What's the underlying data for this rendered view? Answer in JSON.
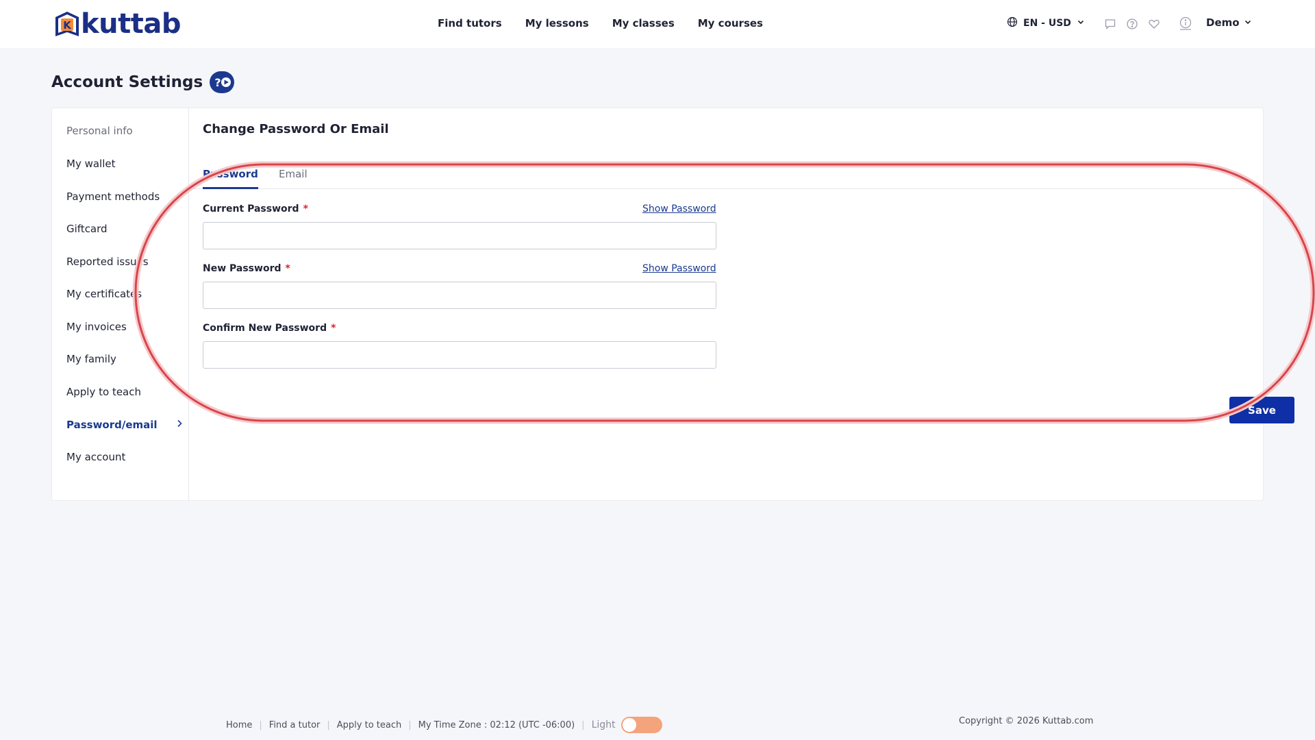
{
  "brand": {
    "name": "kuttab",
    "logo_letter": "K",
    "color": "#1b2f86",
    "accent": "#f28b3b"
  },
  "nav": {
    "items": [
      "Find tutors",
      "My lessons",
      "My classes",
      "My courses"
    ]
  },
  "header": {
    "language": "EN - USD",
    "icons": [
      "globe-icon",
      "chat-icon",
      "help-circle-icon",
      "heart-icon",
      "info-icon"
    ],
    "user_name": "Demo"
  },
  "page": {
    "title": "Account Settings"
  },
  "sidebar": {
    "items": [
      {
        "label": "Personal info",
        "state": "muted"
      },
      {
        "label": "My wallet"
      },
      {
        "label": "Payment methods"
      },
      {
        "label": "Giftcard"
      },
      {
        "label": "Reported issues"
      },
      {
        "label": "My certificates"
      },
      {
        "label": "My invoices"
      },
      {
        "label": "My family"
      },
      {
        "label": "Apply to teach"
      },
      {
        "label": "Password/email",
        "state": "active"
      },
      {
        "label": "My account"
      }
    ]
  },
  "content": {
    "title": "Change Password Or Email",
    "tabs": [
      {
        "label": "Password",
        "active": true
      },
      {
        "label": "Email"
      }
    ],
    "fields": {
      "current": {
        "label": "Current Password",
        "required": "*",
        "show": "Show Password",
        "value": ""
      },
      "new": {
        "label": "New Password",
        "required": "*",
        "show": "Show Password",
        "value": ""
      },
      "confirm": {
        "label": "Confirm New Password",
        "required": "*",
        "value": ""
      }
    },
    "save_label": "Save"
  },
  "footer": {
    "links": [
      "Home",
      "Find a tutor",
      "Apply to teach"
    ],
    "timezone": "My Time Zone : 02:12 (UTC -06:00)",
    "theme_label": "Light",
    "copyright": "Copyright © 2026 Kuttab.com"
  },
  "colors": {
    "primary": "#1b3a8f",
    "save": "#0e2fa6",
    "required": "#d9232e",
    "annotation": "#d9444a",
    "toggle": "#f4a37a"
  }
}
